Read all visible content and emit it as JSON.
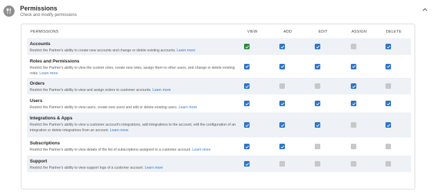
{
  "section": {
    "title": "Permissions",
    "subtitle": "Check and modify permissions",
    "icon": "fork-knife-icon"
  },
  "table": {
    "columns": [
      "PERMISSIONS",
      "VIEW",
      "ADD",
      "EDIT",
      "ASSIGN",
      "DELETE"
    ],
    "learn_more": "Learn more",
    "rows": [
      {
        "title": "Accounts",
        "desc": "Restrict the Partner's ability to create new accounts and change or delete existing accounts.",
        "states": [
          "checked-green",
          "checked",
          "checked",
          "disabled",
          "checked"
        ]
      },
      {
        "title": "Roles and Permissions",
        "desc": "Restrict the Partner's ability to view the custom roles, create new roles, assign them to other users, and change or delete existing roles.",
        "states": [
          "checked",
          "checked",
          "checked",
          "checked",
          "checked"
        ]
      },
      {
        "title": "Orders",
        "desc": "Restrict the Partner's ability to view and assign orders to customer accounts.",
        "states": [
          "checked",
          "disabled",
          "disabled",
          "checked",
          "disabled"
        ]
      },
      {
        "title": "Users",
        "desc": "Restrict the Partner's ability to view users, create new users and edit or delete existing users.",
        "states": [
          "checked",
          "checked",
          "checked",
          "checked",
          "checked"
        ]
      },
      {
        "title": "Integrations & Apps",
        "desc": "Restrict the Partner's ability to view a customer account's integrations, add integrations to the account, edit the configuration of an integration or delete integrations from an account.",
        "states": [
          "checked",
          "checked",
          "checked",
          "disabled",
          "checked"
        ]
      },
      {
        "title": "Subscriptions",
        "desc": "Restrict the Partner's ability to view details of the list of subscriptions assigned to a customer account.",
        "states": [
          "checked",
          "checked",
          "disabled",
          "disabled",
          "disabled"
        ]
      },
      {
        "title": "Support",
        "desc": "Restrict the Partner's ability to view support logs of a customer account.",
        "states": [
          "checked",
          "disabled",
          "disabled",
          "disabled",
          "disabled"
        ]
      }
    ]
  },
  "colors": {
    "accent": "#2f76c7",
    "green": "#2e8b3e",
    "disabled": "#c8c8c8",
    "row_shade": "#eef1f6"
  }
}
